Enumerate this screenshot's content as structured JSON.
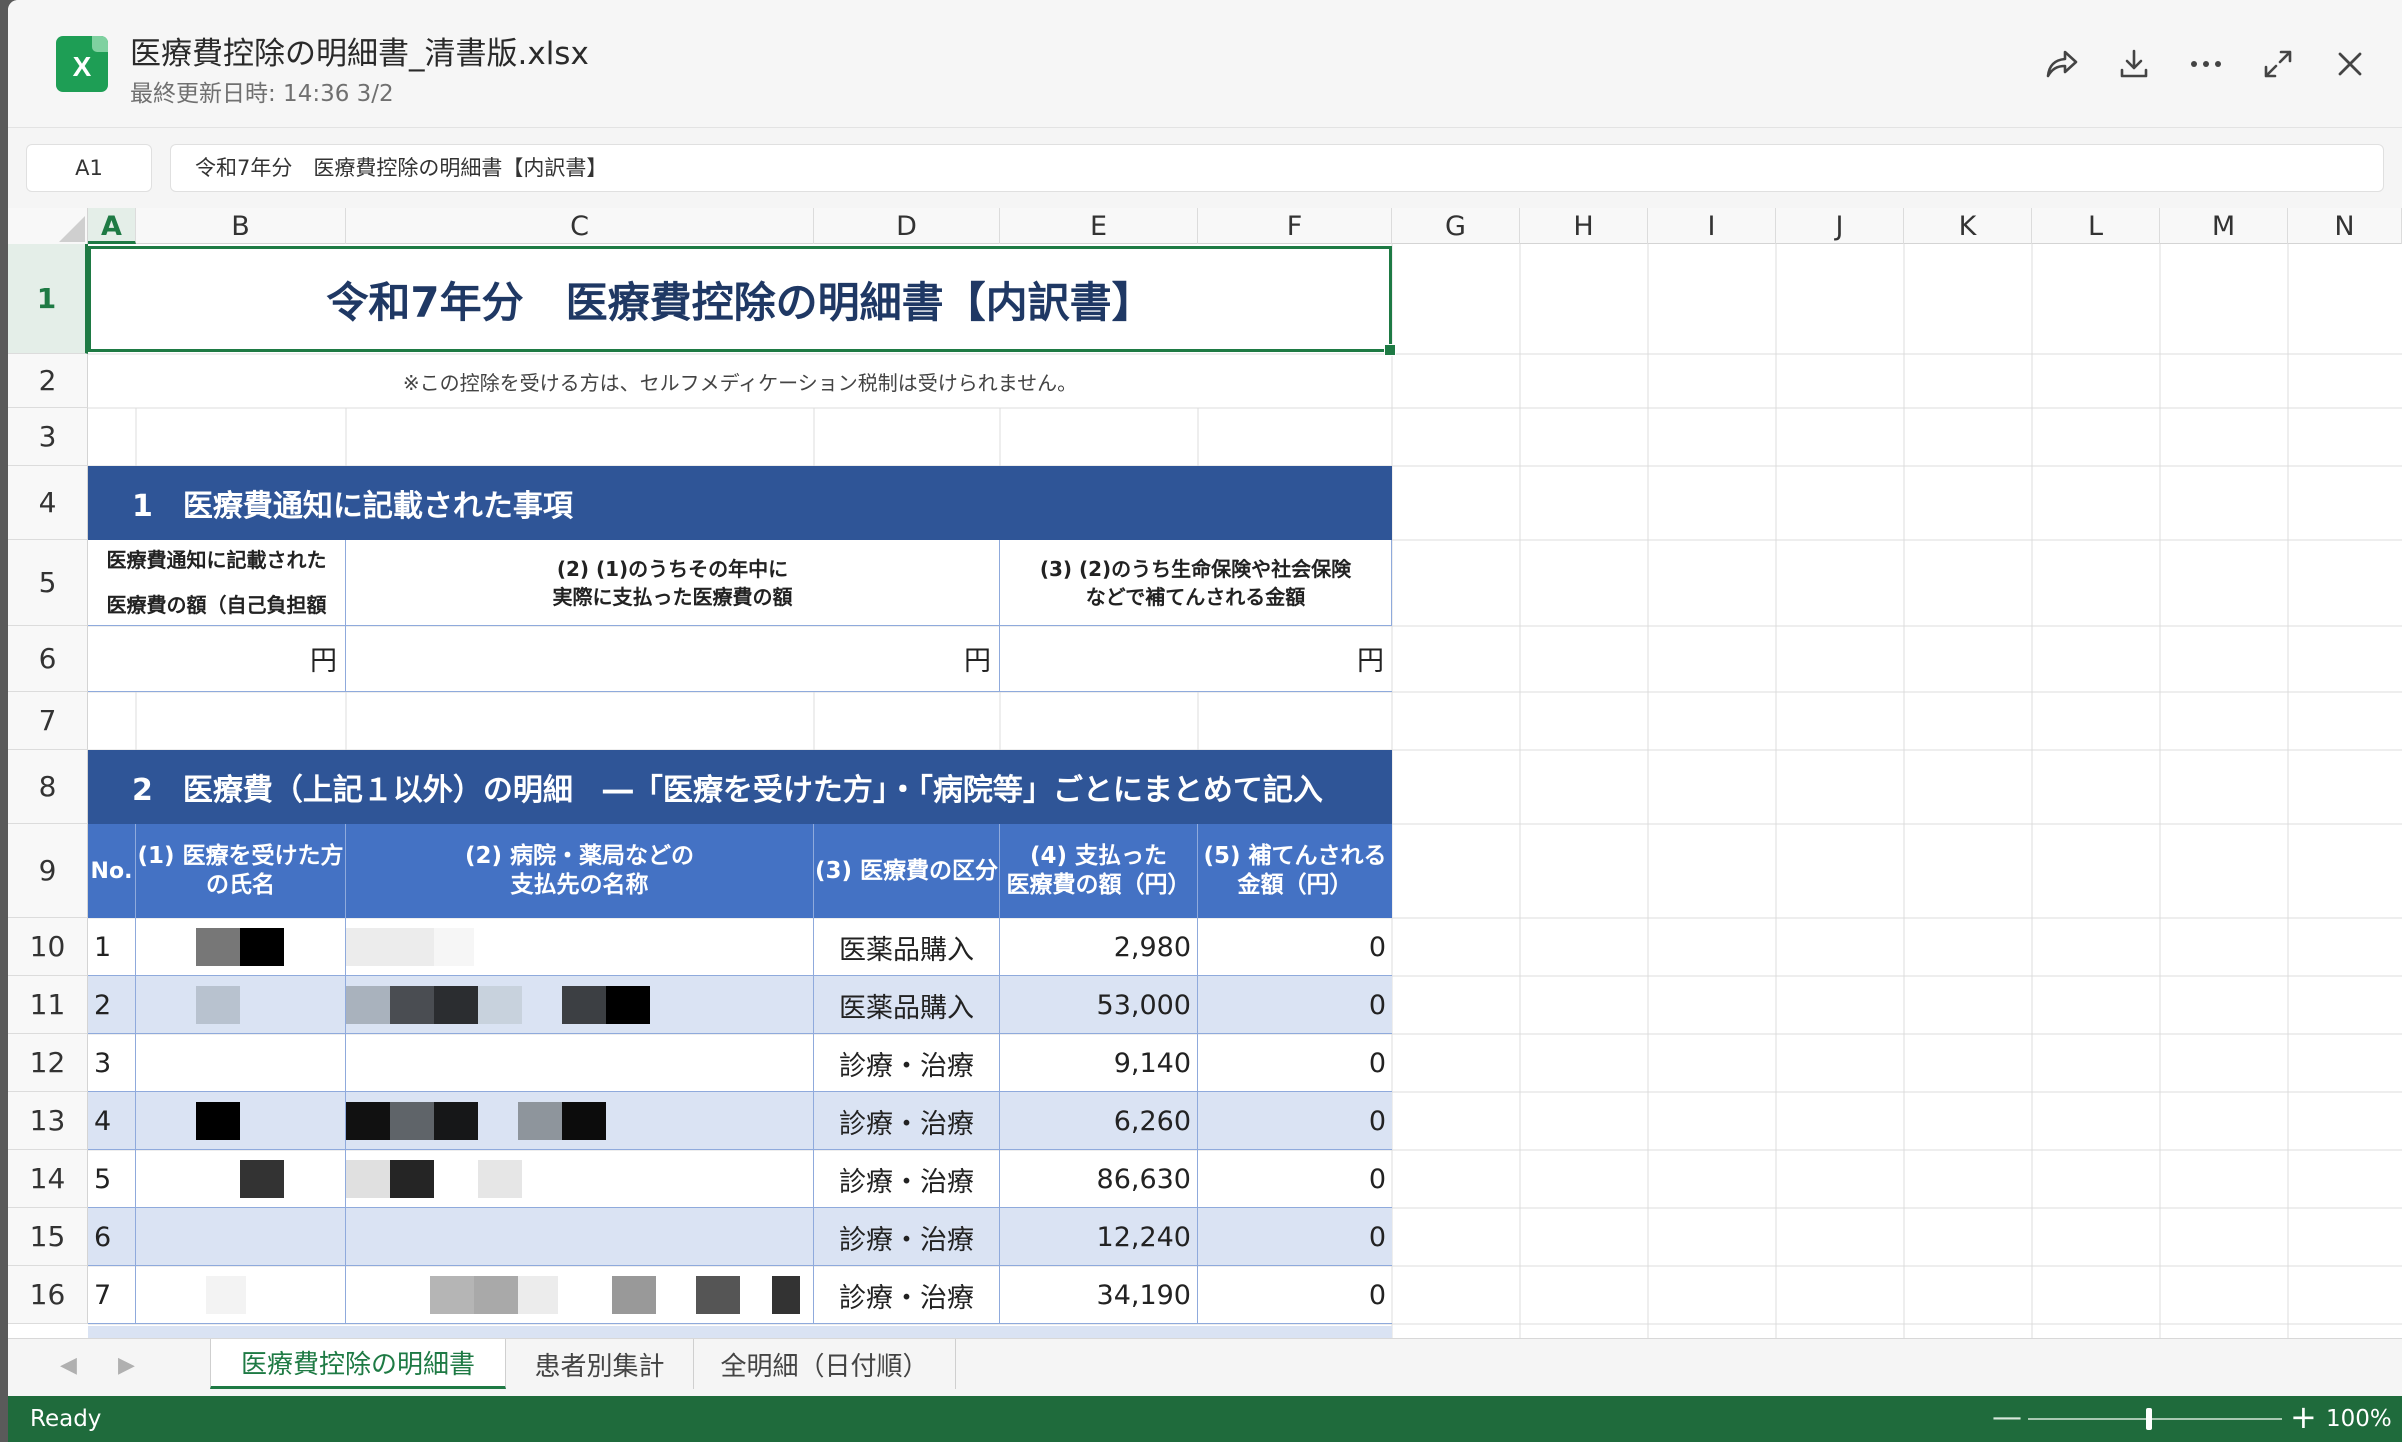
{
  "window": {
    "file_name": "医療費控除の明細書_清書版.xlsx",
    "last_modified": "最終更新日時: 14:36 3/2",
    "file_icon_letter": "X"
  },
  "header_icons": [
    "share-icon",
    "download-icon",
    "more-icon",
    "expand-icon",
    "close-icon"
  ],
  "formula_bar": {
    "cell_ref": "A1",
    "content": "令和7年分　医療費控除の明細書【内訳書】"
  },
  "columns": [
    "A",
    "B",
    "C",
    "D",
    "E",
    "F",
    "G",
    "H",
    "I",
    "J",
    "K",
    "L",
    "M",
    "N"
  ],
  "rows": [
    "1",
    "2",
    "3",
    "4",
    "5",
    "6",
    "7",
    "8",
    "9",
    "10",
    "11",
    "12",
    "13",
    "14",
    "15",
    "16"
  ],
  "sheet": {
    "title": "令和7年分　医療費控除の明細書【内訳書】",
    "note": "※この控除を受ける方は、セルフメディケーション税制は受けられません。",
    "section1": {
      "heading": "1　医療費通知に記載された事項",
      "col1": [
        "医療費通知に記載された",
        "医療費の額（自己負担額"
      ],
      "col2": [
        "(2) (1)のうちその年中に",
        "実際に支払った医療費の額"
      ],
      "col3": [
        "(3) (2)のうち生命保険や社会保険",
        "などで補てんされる金額"
      ],
      "unit": "円"
    },
    "section2": {
      "heading": "2　医療費（上記１以外）の明細　―「医療を受けた方」・「病院等」ごとにまとめて記入",
      "headers": {
        "no": "No.",
        "name": [
          "(1) 医療を受けた方",
          "の氏名"
        ],
        "payee": [
          "(2) 病院・薬局などの",
          "支払先の名称"
        ],
        "category": "(3) 医療費の区分",
        "amount": [
          "(4) 支払った",
          "医療費の額（円）"
        ],
        "reimbursed": [
          "(5) 補てんされる",
          "金額（円）"
        ]
      },
      "rows": [
        {
          "no": "1",
          "category": "医薬品購入",
          "amount": "2,980",
          "reimbursed": "0"
        },
        {
          "no": "2",
          "category": "医薬品購入",
          "amount": "53,000",
          "reimbursed": "0"
        },
        {
          "no": "3",
          "category": "診療・治療",
          "amount": "9,140",
          "reimbursed": "0"
        },
        {
          "no": "4",
          "category": "診療・治療",
          "amount": "6,260",
          "reimbursed": "0"
        },
        {
          "no": "5",
          "category": "診療・治療",
          "amount": "86,630",
          "reimbursed": "0"
        },
        {
          "no": "6",
          "category": "診療・治療",
          "amount": "12,240",
          "reimbursed": "0"
        },
        {
          "no": "7",
          "category": "診療・治療",
          "amount": "34,190",
          "reimbursed": "0"
        }
      ]
    }
  },
  "tabs": {
    "items": [
      "医療費控除の明細書",
      "患者別集計",
      "全明細（日付順）"
    ],
    "active": 0
  },
  "status": {
    "text": "Ready",
    "zoom": "100%",
    "zoom_minus": "—",
    "zoom_plus": "+"
  },
  "colors": {
    "accent_green": "#1e7a44",
    "header_blue": "#2f5597",
    "table_header_blue": "#4472c4",
    "row_alt": "#dae3f3",
    "title_navy": "#1f3864"
  }
}
